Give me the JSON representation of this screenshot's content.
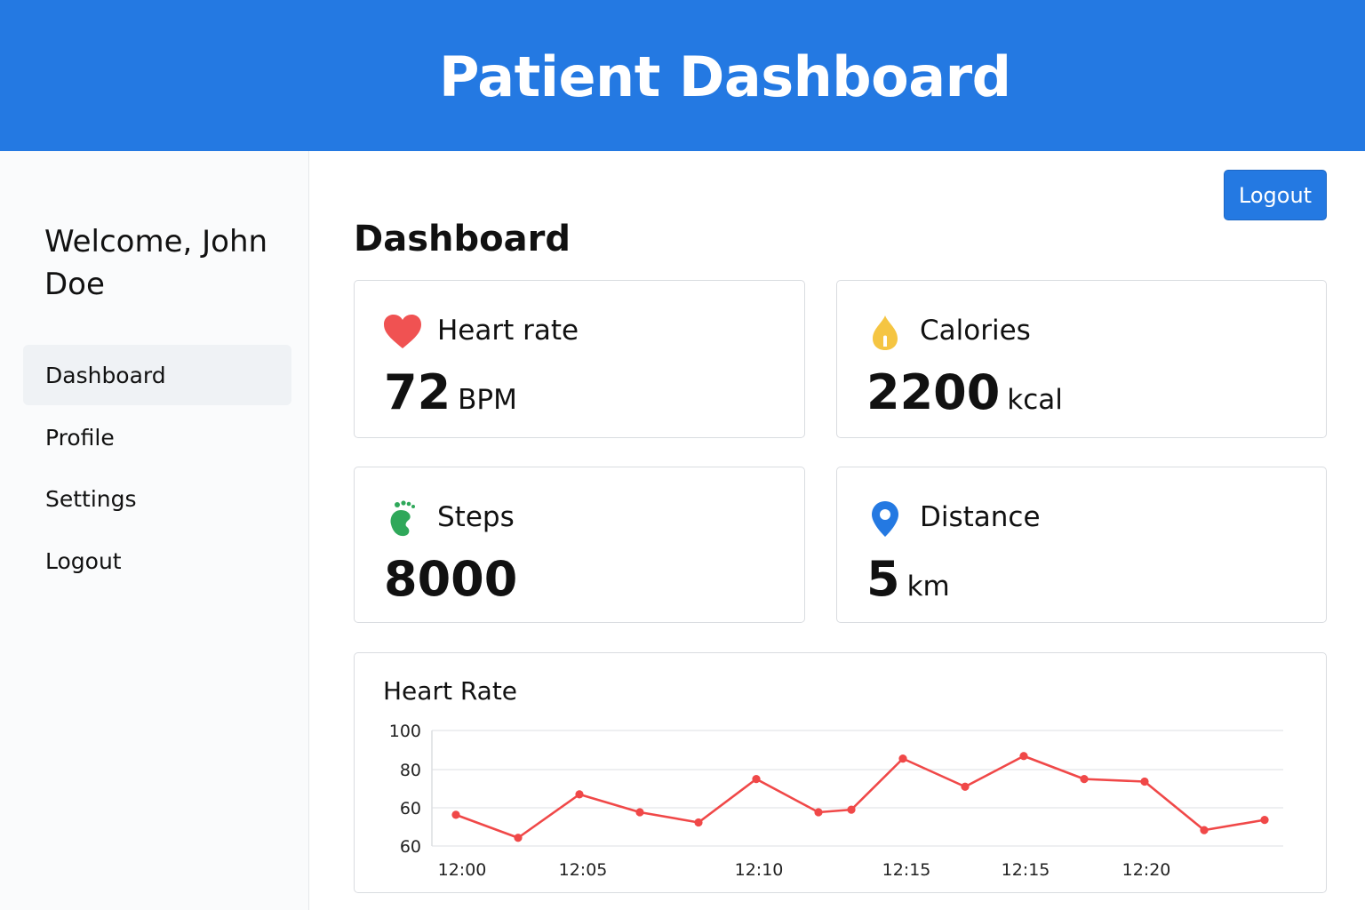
{
  "header": {
    "title": "Patient Dashboard"
  },
  "sidebar": {
    "welcome": "Welcome, John Doe",
    "items": [
      {
        "label": "Dashboard",
        "active": true
      },
      {
        "label": "Profile",
        "active": false
      },
      {
        "label": "Settings",
        "active": false
      },
      {
        "label": "Logout",
        "active": false
      }
    ]
  },
  "toolbar": {
    "logout_label": "Logout"
  },
  "main": {
    "title": "Dashboard",
    "cards": [
      {
        "label": "Heart rate",
        "value": "72",
        "unit": "BPM",
        "icon": "heart-icon",
        "color": "#f05252"
      },
      {
        "label": "Calories",
        "value": "2200",
        "unit": "kcal",
        "icon": "flame-icon",
        "color": "#f5c542"
      },
      {
        "label": "Steps",
        "value": "8000",
        "unit": "",
        "icon": "footprint-icon",
        "color": "#2fa85a"
      },
      {
        "label": "Distance",
        "value": "5",
        "unit": "km",
        "icon": "map-pin-icon",
        "color": "#2479e2"
      }
    ]
  },
  "chart_data": {
    "type": "line",
    "title": "Heart Rate",
    "xlabel": "",
    "ylabel": "",
    "yticks": [
      "100",
      "80",
      "60",
      "60"
    ],
    "xticks": [
      "12:00",
      "12:05",
      "12:10",
      "12:15",
      "12:15",
      "12:20"
    ],
    "ylim": [
      60,
      100
    ],
    "grid": true,
    "line_color": "#f04848",
    "series": [
      {
        "values": [
          67,
          58,
          75,
          68,
          64,
          81,
          68,
          69,
          89,
          78,
          90,
          81,
          80,
          61,
          65
        ]
      }
    ]
  }
}
